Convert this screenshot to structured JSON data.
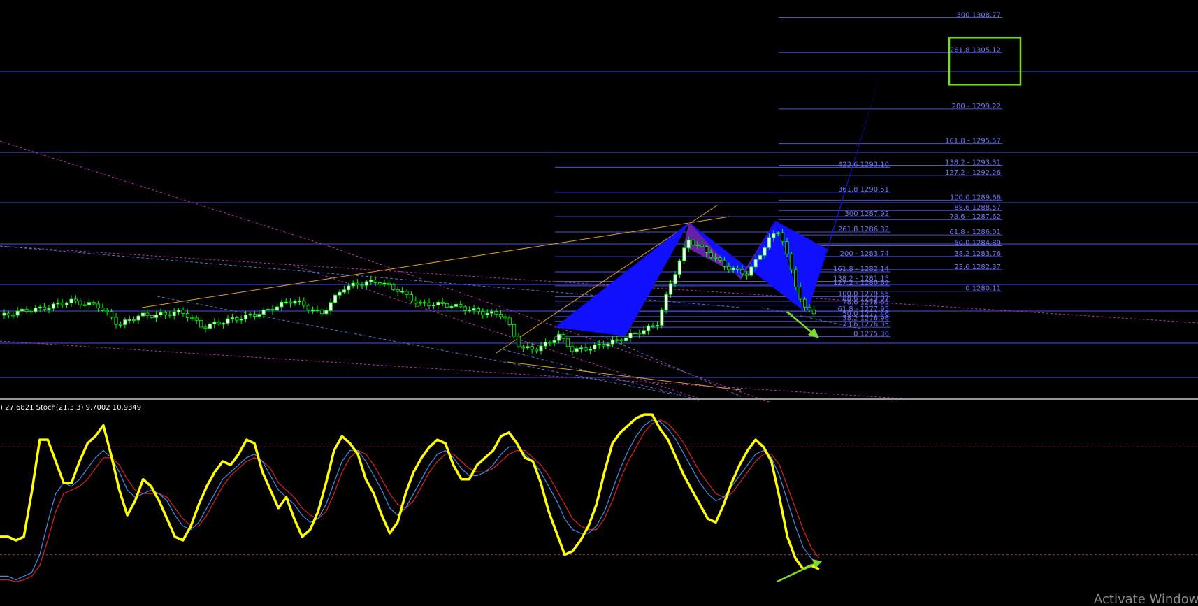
{
  "chart_data": [
    {
      "type": "candlestick",
      "title": "",
      "fib_labels": [
        {
          "text": "300 1308.77",
          "group": "right"
        },
        {
          "text": "261.8 1305.12",
          "group": "right"
        },
        {
          "text": "200 - 1299.22",
          "group": "right"
        },
        {
          "text": "161.8 - 1295.57",
          "group": "right"
        },
        {
          "text": "138.2 - 1293.31",
          "group": "right"
        },
        {
          "text": "127.2 - 1292.26",
          "group": "right"
        },
        {
          "text": "100.0 1289.66",
          "group": "right"
        },
        {
          "text": "88.6 1288.57",
          "group": "right"
        },
        {
          "text": "78.6 - 1287.62",
          "group": "right"
        },
        {
          "text": "61.8 - 1286.01",
          "group": "right"
        },
        {
          "text": "50.0 1284.89",
          "group": "right"
        },
        {
          "text": "38.2 1283.76",
          "group": "right"
        },
        {
          "text": "23.6 1282.37",
          "group": "right"
        },
        {
          "text": "0 1280.11",
          "group": "right"
        },
        {
          "text": "423.6 1293.10",
          "group": "left"
        },
        {
          "text": "361.8 1290.51",
          "group": "left"
        },
        {
          "text": "300 1287.92",
          "group": "left"
        },
        {
          "text": "261.8 1286.32",
          "group": "left"
        },
        {
          "text": "200 - 1283.74",
          "group": "left"
        },
        {
          "text": "161.8 - 1282.14",
          "group": "left"
        },
        {
          "text": "138.2 - 1281.15",
          "group": "left"
        },
        {
          "text": "127.2 - 1280.69",
          "group": "left"
        },
        {
          "text": "100.0 1279.55",
          "group": "left"
        },
        {
          "text": "88.6 1279.07",
          "group": "left"
        },
        {
          "text": "78.6 1278.65",
          "group": "left"
        },
        {
          "text": "61.8 - 1277.95",
          "group": "left"
        },
        {
          "text": "50.0 1277.46",
          "group": "left"
        },
        {
          "text": "38.2 1276.96",
          "group": "left"
        },
        {
          "text": "23.6 1276.35",
          "group": "left"
        },
        {
          "text": "0 1275.36",
          "group": "left"
        }
      ],
      "highlighted_level": "261.8 1305.12",
      "colors": {
        "background": "#000000",
        "bull_candle": "#ffffff",
        "bear_candle": "#000000",
        "candle_outline": "#00ff00",
        "fib_line": "#4a52e0",
        "fib_text": "#6f79ff",
        "pattern_fill": "#1010ff",
        "pattern_overlap": "#6a1fa8",
        "trendline_orange": "#e0a020",
        "trendline_magenta": "#c030c0",
        "trendline_blue_dashed": "#4a78d0",
        "arrow": "#7ddc1f",
        "highlight_box": "#7ddc1f"
      }
    },
    {
      "type": "line",
      "indicator": "Stochastic",
      "legend_text": ") 27.6821  Stoch(21,3,3) 9.7002 10.9349",
      "series": [
        {
          "name": "",
          "color": "#ffff00",
          "values": [
            30,
            30,
            28,
            30,
            55,
            84,
            84,
            72,
            60,
            60,
            72,
            82,
            86,
            92,
            75,
            56,
            42,
            50,
            62,
            58,
            50,
            40,
            30,
            28,
            36,
            48,
            58,
            66,
            72,
            70,
            76,
            84,
            82,
            66,
            56,
            46,
            52,
            40,
            30,
            34,
            44,
            60,
            78,
            86,
            82,
            76,
            62,
            54,
            42,
            32,
            38,
            54,
            66,
            74,
            80,
            84,
            82,
            70,
            62,
            62,
            70,
            74,
            78,
            86,
            88,
            82,
            74,
            72,
            60,
            44,
            32,
            20,
            22,
            28,
            36,
            48,
            66,
            82,
            88,
            92,
            96,
            98,
            98,
            90,
            84,
            74,
            64,
            56,
            48,
            40,
            38,
            48,
            60,
            70,
            78,
            84,
            80,
            72,
            52,
            30,
            18,
            12,
            14,
            12
          ]
        },
        {
          "name": "",
          "color": "#3b8ef0",
          "values": [
            8,
            8,
            6,
            8,
            10,
            20,
            38,
            54,
            60,
            58,
            62,
            68,
            74,
            78,
            74,
            66,
            56,
            52,
            54,
            56,
            54,
            50,
            42,
            36,
            34,
            38,
            46,
            54,
            62,
            66,
            70,
            74,
            76,
            72,
            64,
            56,
            52,
            48,
            42,
            38,
            40,
            48,
            60,
            72,
            78,
            78,
            72,
            64,
            56,
            46,
            42,
            46,
            54,
            62,
            70,
            76,
            78,
            74,
            68,
            64,
            64,
            66,
            70,
            76,
            80,
            80,
            76,
            72,
            66,
            58,
            50,
            40,
            34,
            32,
            32,
            36,
            44,
            56,
            68,
            78,
            86,
            92,
            95,
            94,
            90,
            84,
            76,
            68,
            60,
            54,
            50,
            52,
            58,
            64,
            70,
            76,
            78,
            74,
            64,
            50,
            36,
            24,
            18,
            14
          ]
        },
        {
          "name": "",
          "color": "#e02020",
          "values": [
            6,
            6,
            5,
            6,
            8,
            14,
            28,
            44,
            54,
            56,
            58,
            62,
            68,
            74,
            74,
            70,
            62,
            56,
            54,
            54,
            54,
            52,
            46,
            40,
            36,
            36,
            42,
            50,
            58,
            64,
            68,
            72,
            74,
            72,
            68,
            60,
            56,
            52,
            46,
            42,
            40,
            44,
            54,
            66,
            74,
            78,
            76,
            70,
            62,
            54,
            48,
            46,
            50,
            58,
            66,
            72,
            76,
            76,
            72,
            68,
            66,
            66,
            68,
            72,
            76,
            78,
            78,
            74,
            70,
            64,
            56,
            48,
            40,
            36,
            34,
            34,
            40,
            50,
            62,
            72,
            80,
            88,
            93,
            95,
            93,
            88,
            82,
            74,
            66,
            60,
            54,
            52,
            54,
            60,
            66,
            72,
            76,
            76,
            70,
            58,
            46,
            34,
            24,
            18
          ]
        }
      ],
      "reference_levels": [
        20,
        80
      ],
      "ylim": [
        0,
        100
      ]
    }
  ],
  "watermark": "Activate Window"
}
